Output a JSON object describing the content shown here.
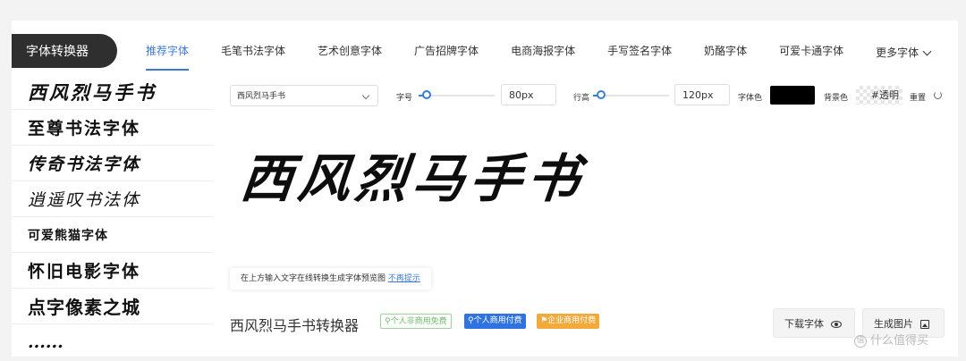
{
  "header": {
    "brand": "字体转换器",
    "tabs": [
      {
        "label": "推荐字体",
        "active": true
      },
      {
        "label": "毛笔书法字体"
      },
      {
        "label": "艺术创意字体"
      },
      {
        "label": "广告招牌字体"
      },
      {
        "label": "电商海报字体"
      },
      {
        "label": "手写签名字体"
      },
      {
        "label": "奶酪字体"
      },
      {
        "label": "可爱卡通字体"
      }
    ],
    "more_label": "更多字体"
  },
  "sidebar": {
    "items": [
      {
        "label": "西风烈马手书"
      },
      {
        "label": "至尊书法字体"
      },
      {
        "label": "传奇书法字体"
      },
      {
        "label": "逍遥叹书法体"
      },
      {
        "label": "可爱熊猫字体"
      },
      {
        "label": "怀旧电影字体"
      },
      {
        "label": "点字像素之城"
      },
      {
        "label": "......"
      }
    ]
  },
  "controls": {
    "font_select": "西风烈马手书",
    "size_label": "字号",
    "size_value": "80px",
    "size_level": 0.1,
    "line_height_label": "行高",
    "line_height_value": "120px",
    "line_height_level": 0.1,
    "color_label": "字体色",
    "font_color": "#000000",
    "bg_label": "背景色",
    "bg_value": "#透明",
    "reset_label": "重置"
  },
  "preview": {
    "text": "西风烈马手书"
  },
  "tip": {
    "text": "在上方输入文字在线转换生成字体预览图",
    "link": "不再提示"
  },
  "footer": {
    "title": "西风烈马手书转换器",
    "badges": [
      "个人非商用免费",
      "个人商用付费",
      "企业商用付费"
    ],
    "download_label": "下载字体",
    "generate_label": "生成图片"
  },
  "watermark": "什么值得买"
}
